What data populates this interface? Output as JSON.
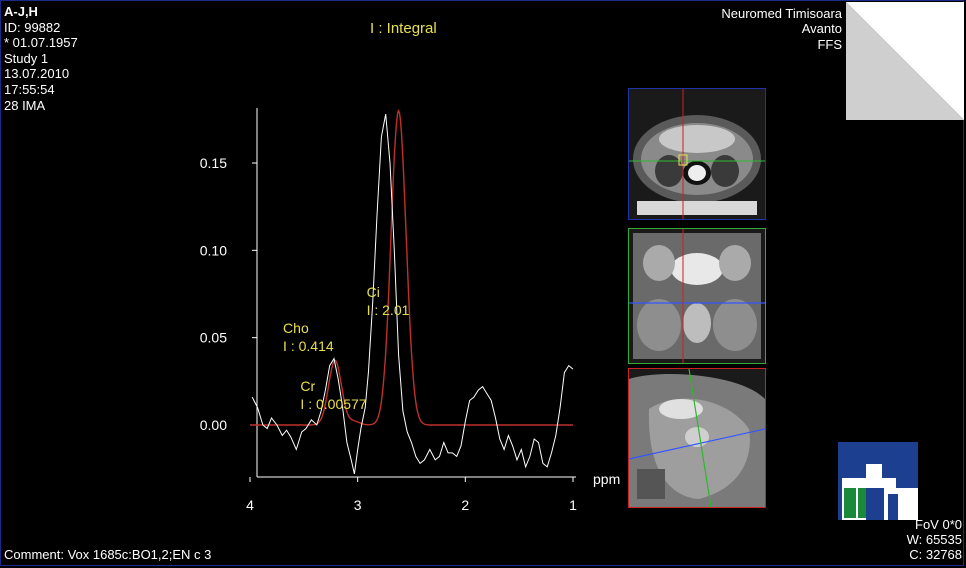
{
  "patient": {
    "name": "A-J,H",
    "id": "ID: 99882",
    "birth": "* 01.07.1957",
    "study": "Study 1",
    "date": "13.07.2010",
    "time": "17:55:54",
    "images": "28 IMA"
  },
  "institution": {
    "name": "Neuromed Timisoara",
    "scanner": "Avanto",
    "position": "FFS"
  },
  "comment": "Comment: Vox 1685c:BO1,2;EN  c  3",
  "display": {
    "fov": "FoV 0*0",
    "window": "W: 65535",
    "center": "C: 32768"
  },
  "colors": {
    "background": "#000000",
    "annotation": "#e8e04a",
    "fit_curve": "#c0302a",
    "spectrum": "#ffffff",
    "axial_border": "#2233aa",
    "coronal_border": "#33aa33",
    "sagittal_border": "#cc2222",
    "logo_blue": "#1c3f8f",
    "logo_green": "#1a8a3a"
  },
  "images": {
    "axial": {
      "name": "axial-localizer",
      "border_color": "#2233aa"
    },
    "coronal": {
      "name": "coronal-localizer",
      "border_color": "#33aa33"
    },
    "sagittal": {
      "name": "sagittal-localizer",
      "border_color": "#cc2222"
    }
  },
  "chart_data": {
    "type": "line",
    "title": "I : Integral",
    "xlabel": "ppm",
    "ylabel": "",
    "x_reversed": true,
    "xlim": [
      4.0,
      1.0
    ],
    "ylim": [
      -0.03,
      0.18
    ],
    "x_ticks": [
      "4",
      "3",
      "2",
      "1"
    ],
    "y_ticks": [
      "0.15",
      "0.10",
      "0.05",
      "0.00"
    ],
    "y_tick_values": [
      0.15,
      0.1,
      0.05,
      0.0
    ],
    "x_tick_values": [
      4,
      3,
      2,
      1
    ],
    "peaks": [
      {
        "name": "Ci",
        "integral": "I : 2.01",
        "ppm": 2.62,
        "height": 0.18,
        "width": 0.07
      },
      {
        "name": "Cho",
        "integral": "I : 0.414",
        "ppm": 3.21,
        "height": 0.037,
        "width": 0.06
      },
      {
        "name": "Cr",
        "integral": "I : 0.00577",
        "ppm": 3.03,
        "height": 0.002,
        "width": 0.05
      }
    ],
    "series": [
      {
        "name": "spectrum",
        "x": [
          3.98,
          3.93,
          3.88,
          3.84,
          3.8,
          3.75,
          3.7,
          3.66,
          3.62,
          3.57,
          3.52,
          3.48,
          3.43,
          3.38,
          3.34,
          3.3,
          3.26,
          3.22,
          3.18,
          3.14,
          3.1,
          3.06,
          3.03,
          3.0,
          2.97,
          2.93,
          2.9,
          2.86,
          2.82,
          2.78,
          2.74,
          2.7,
          2.66,
          2.62,
          2.58,
          2.54,
          2.5,
          2.46,
          2.42,
          2.38,
          2.33,
          2.28,
          2.24,
          2.2,
          2.16,
          2.12,
          2.08,
          2.04,
          2.0,
          1.96,
          1.92,
          1.88,
          1.84,
          1.8,
          1.76,
          1.72,
          1.68,
          1.64,
          1.6,
          1.56,
          1.52,
          1.48,
          1.44,
          1.4,
          1.36,
          1.32,
          1.28,
          1.24,
          1.2,
          1.16,
          1.12,
          1.08,
          1.04,
          1.0
        ],
        "y": [
          0.016,
          0.01,
          0.0,
          -0.002,
          0.004,
          0.0,
          -0.006,
          -0.003,
          -0.007,
          -0.014,
          -0.004,
          -0.002,
          0.003,
          0.0,
          0.008,
          0.02,
          0.034,
          0.038,
          0.026,
          0.01,
          -0.01,
          -0.02,
          -0.028,
          -0.014,
          -0.002,
          0.01,
          0.03,
          0.07,
          0.12,
          0.165,
          0.178,
          0.15,
          0.1,
          0.04,
          0.008,
          -0.004,
          -0.01,
          -0.018,
          -0.022,
          -0.02,
          -0.014,
          -0.02,
          -0.018,
          -0.01,
          -0.016,
          -0.016,
          -0.018,
          -0.012,
          0.002,
          0.014,
          0.016,
          0.02,
          0.022,
          0.018,
          0.014,
          0.004,
          -0.008,
          -0.014,
          -0.006,
          -0.012,
          -0.02,
          -0.014,
          -0.024,
          -0.018,
          -0.008,
          -0.01,
          -0.022,
          -0.024,
          -0.016,
          -0.006,
          0.01,
          0.03,
          0.034,
          0.032
        ]
      }
    ]
  }
}
